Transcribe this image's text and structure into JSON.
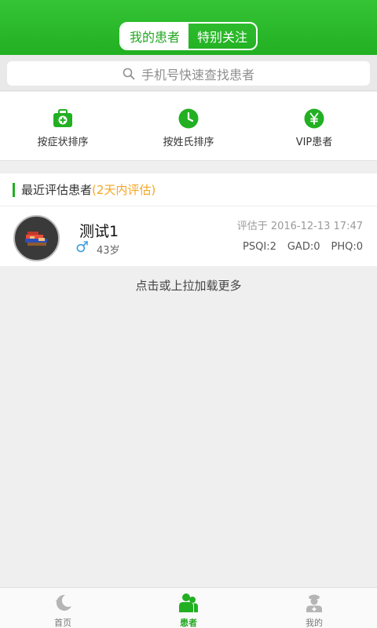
{
  "header": {
    "tabs": [
      {
        "label": "我的患者",
        "active": true
      },
      {
        "label": "特别关注",
        "active": false
      }
    ]
  },
  "search": {
    "placeholder": "手机号快速查找患者"
  },
  "sort_options": [
    {
      "label": "按症状排序",
      "icon": "medical-kit-icon"
    },
    {
      "label": "按姓氏排序",
      "icon": "clock-icon"
    },
    {
      "label": "VIP患者",
      "icon": "yen-icon"
    }
  ],
  "recent": {
    "title": "最近评估患者",
    "subtitle": "(2天内评估)",
    "patients": [
      {
        "name": "测试1",
        "gender_symbol": "♂",
        "age": "43岁",
        "eval_time": "评估于 2016-12-13 17:47",
        "scores": [
          "PSQI:2",
          "GAD:0",
          "PHQ:0"
        ]
      }
    ]
  },
  "load_more": "点击或上拉加载更多",
  "tabbar": {
    "items": [
      {
        "label": "首页",
        "icon": "moon-icon",
        "active": false
      },
      {
        "label": "患者",
        "icon": "patients-icon",
        "active": true
      },
      {
        "label": "我的",
        "icon": "nurse-icon",
        "active": false
      }
    ]
  },
  "colors": {
    "brand": "#22b022",
    "accent": "#f5a623",
    "male": "#3a9fe0"
  }
}
